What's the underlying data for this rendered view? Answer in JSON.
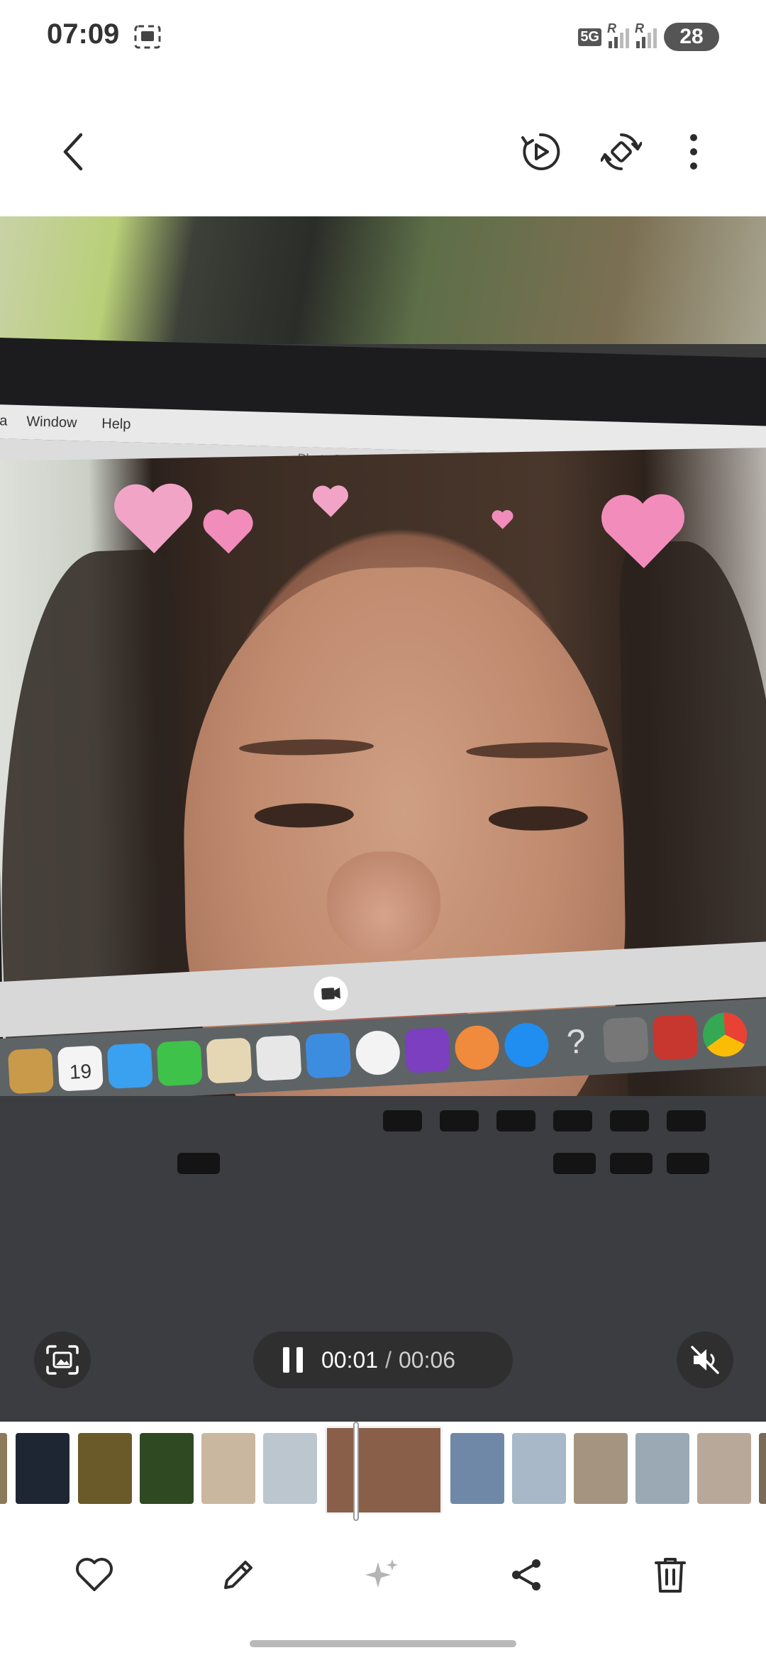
{
  "status_bar": {
    "time": "07:09",
    "network_badge": "5G",
    "roaming_1": "R",
    "roaming_2": "R",
    "battery": "28"
  },
  "toolbar": {
    "back_icon": "chevron-left-icon",
    "actions": [
      "play-circle-icon",
      "rotate-icon",
      "more-vertical-icon"
    ]
  },
  "video_content": {
    "menubar_items": [
      "a",
      "Window",
      "Help"
    ],
    "window_title": "Photo Booth",
    "calendar_day": "19"
  },
  "player": {
    "current_time": "00:01",
    "separator": "/",
    "total_time": "00:06",
    "capture_icon": "screen-capture-icon",
    "pause_icon": "pause-icon",
    "mute_icon": "mute-icon"
  },
  "filmstrip": {
    "thumbnails": [
      {
        "color": "#8c7a5a"
      },
      {
        "color": "#1f2633"
      },
      {
        "color": "#6a5a2a"
      },
      {
        "color": "#2f4a22"
      },
      {
        "color": "#c9b7a0"
      },
      {
        "color": "#bcc6cf"
      },
      {
        "color": "#8a5f49"
      },
      {
        "color": "#6f88a8"
      },
      {
        "color": "#a8b8c8"
      },
      {
        "color": "#a49480"
      },
      {
        "color": "#9aa9b3"
      },
      {
        "color": "#b8a89a"
      },
      {
        "color": "#7a6a5a"
      }
    ]
  },
  "bottom_bar": {
    "actions": [
      "heart-icon",
      "pencil-icon",
      "sparkle-icon",
      "share-icon",
      "trash-icon"
    ]
  },
  "colors": {
    "accent_pink": "#f2a4c6",
    "icon_dark": "#2b2b2b",
    "icon_disabled": "#b5b5b5"
  }
}
